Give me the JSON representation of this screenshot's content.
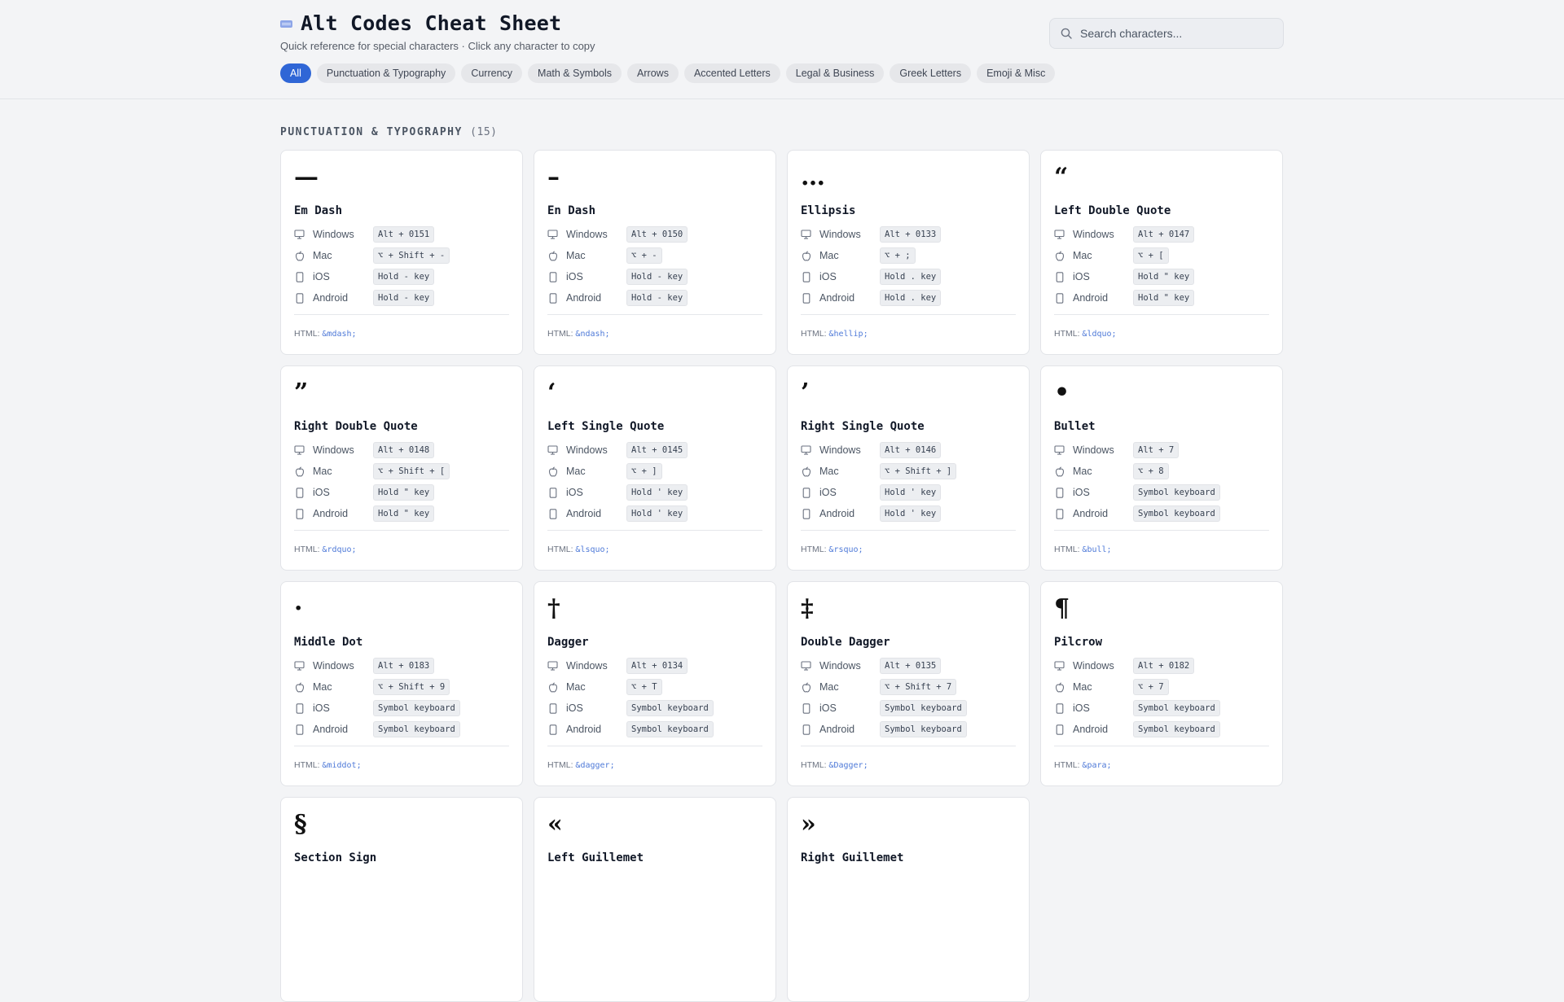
{
  "header": {
    "title": "Alt Codes Cheat Sheet",
    "subtitle": "Quick reference for special characters · Click any character to copy",
    "search_placeholder": "Search characters..."
  },
  "filters": [
    "All",
    "Punctuation & Typography",
    "Currency",
    "Math & Symbols",
    "Arrows",
    "Accented Letters",
    "Legal & Business",
    "Greek Letters",
    "Emoji & Misc"
  ],
  "active_filter": "All",
  "section": {
    "title": "PUNCTUATION & TYPOGRAPHY",
    "count": "(15)"
  },
  "platform_labels": [
    "Windows",
    "Mac",
    "iOS",
    "Android"
  ],
  "html_label": "HTML:",
  "cards": [
    {
      "glyph": "—",
      "name": "Em Dash",
      "codes": [
        "Alt + 0151",
        "⌥ + Shift + -",
        "Hold - key",
        "Hold - key"
      ],
      "html": "&mdash;"
    },
    {
      "glyph": "–",
      "name": "En Dash",
      "codes": [
        "Alt + 0150",
        "⌥ + -",
        "Hold - key",
        "Hold - key"
      ],
      "html": "&ndash;"
    },
    {
      "glyph": "…",
      "name": "Ellipsis",
      "codes": [
        "Alt + 0133",
        "⌥ + ;",
        "Hold . key",
        "Hold . key"
      ],
      "html": "&hellip;"
    },
    {
      "glyph": "“",
      "name": "Left Double Quote",
      "codes": [
        "Alt + 0147",
        "⌥ + [",
        "Hold \" key",
        "Hold \" key"
      ],
      "html": "&ldquo;"
    },
    {
      "glyph": "”",
      "name": "Right Double Quote",
      "codes": [
        "Alt + 0148",
        "⌥ + Shift + [",
        "Hold \" key",
        "Hold \" key"
      ],
      "html": "&rdquo;"
    },
    {
      "glyph": "‘",
      "name": "Left Single Quote",
      "codes": [
        "Alt + 0145",
        "⌥ + ]",
        "Hold ' key",
        "Hold ' key"
      ],
      "html": "&lsquo;"
    },
    {
      "glyph": "’",
      "name": "Right Single Quote",
      "codes": [
        "Alt + 0146",
        "⌥ + Shift + ]",
        "Hold ' key",
        "Hold ' key"
      ],
      "html": "&rsquo;"
    },
    {
      "glyph": "•",
      "name": "Bullet",
      "codes": [
        "Alt + 7",
        "⌥ + 8",
        "Symbol keyboard",
        "Symbol keyboard"
      ],
      "html": "&bull;"
    },
    {
      "glyph": "·",
      "name": "Middle Dot",
      "codes": [
        "Alt + 0183",
        "⌥ + Shift + 9",
        "Symbol keyboard",
        "Symbol keyboard"
      ],
      "html": "&middot;"
    },
    {
      "glyph": "†",
      "name": "Dagger",
      "codes": [
        "Alt + 0134",
        "⌥ + T",
        "Symbol keyboard",
        "Symbol keyboard"
      ],
      "html": "&dagger;"
    },
    {
      "glyph": "‡",
      "name": "Double Dagger",
      "codes": [
        "Alt + 0135",
        "⌥ + Shift + 7",
        "Symbol keyboard",
        "Symbol keyboard"
      ],
      "html": "&Dagger;"
    },
    {
      "glyph": "¶",
      "name": "Pilcrow",
      "codes": [
        "Alt + 0182",
        "⌥ + 7",
        "Symbol keyboard",
        "Symbol keyboard"
      ],
      "html": "&para;"
    },
    {
      "glyph": "§",
      "name": "Section Sign",
      "codes": [],
      "html": ""
    },
    {
      "glyph": "«",
      "name": "Left Guillemet",
      "codes": [],
      "html": ""
    },
    {
      "glyph": "»",
      "name": "Right Guillemet",
      "codes": [],
      "html": ""
    }
  ],
  "colors": {
    "accent": "#2f66d6",
    "background": "#f3f4f6",
    "card": "#ffffff",
    "entity": "#4f7ad8"
  },
  "icons": [
    "keyboard-icon",
    "search-icon",
    "monitor-icon",
    "apple-icon",
    "phone-icon"
  ]
}
